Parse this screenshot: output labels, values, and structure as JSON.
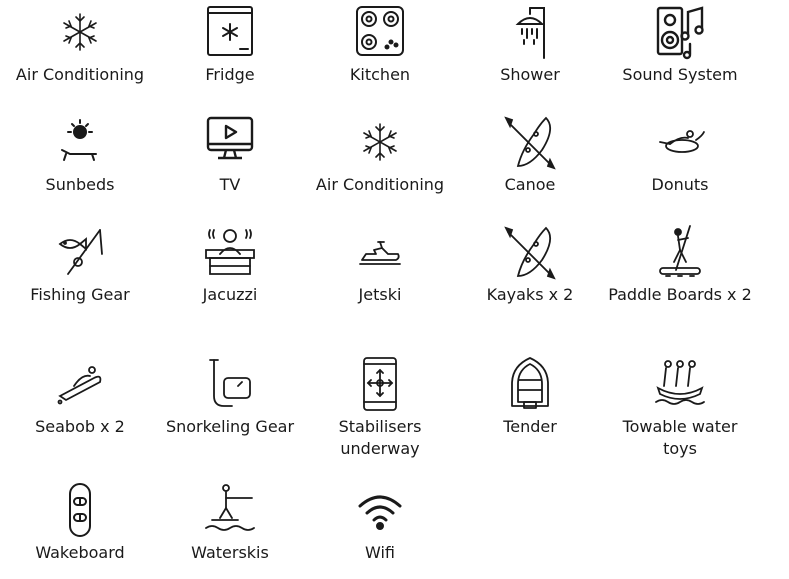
{
  "amenities": [
    {
      "label": "Air Conditioning",
      "icon": "snowflake-icon"
    },
    {
      "label": "Fridge",
      "icon": "fridge-icon"
    },
    {
      "label": "Kitchen",
      "icon": "stove-icon"
    },
    {
      "label": "Shower",
      "icon": "shower-icon"
    },
    {
      "label": "Sound System",
      "icon": "speaker-music-icon"
    },
    {
      "label": "Sunbeds",
      "icon": "sunbed-icon"
    },
    {
      "label": "TV",
      "icon": "tv-icon"
    },
    {
      "label": "Air Conditioning",
      "icon": "snowflake-icon"
    },
    {
      "label": "Canoe",
      "icon": "canoe-icon"
    },
    {
      "label": "Donuts",
      "icon": "donut-ride-icon"
    },
    {
      "label": "Fishing Gear",
      "icon": "fishing-icon"
    },
    {
      "label": "Jacuzzi",
      "icon": "jacuzzi-icon"
    },
    {
      "label": "Jetski",
      "icon": "jetski-icon"
    },
    {
      "label": "Kayaks x 2",
      "icon": "kayak-icon"
    },
    {
      "label": "Paddle Boards x 2",
      "icon": "paddle-board-icon"
    },
    {
      "label": "Seabob x 2",
      "icon": "seabob-icon"
    },
    {
      "label": "Snorkeling Gear",
      "icon": "snorkel-icon"
    },
    {
      "label": "Stabilisers underway",
      "icon": "stabiliser-icon"
    },
    {
      "label": "Tender",
      "icon": "tender-icon"
    },
    {
      "label": "Towable water toys",
      "icon": "towable-icon"
    },
    {
      "label": "Wakeboard",
      "icon": "wakeboard-icon"
    },
    {
      "label": "Waterskis",
      "icon": "waterski-icon"
    },
    {
      "label": "Wifi",
      "icon": "wifi-icon"
    }
  ]
}
